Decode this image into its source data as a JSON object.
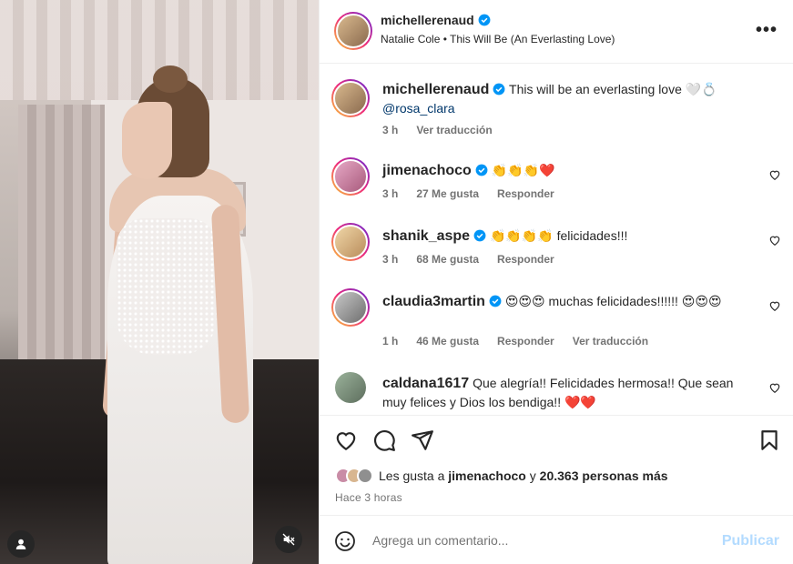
{
  "header": {
    "username": "michellerenaud",
    "music": "Natalie Cole • This Will Be (An Everlasting Love)",
    "more_icon": "more-horizontal-icon"
  },
  "caption": {
    "username": "michellerenaud",
    "text": " This will be an everlasting love 🤍💍",
    "mention": "@rosa_clara",
    "time": "3 h",
    "translate": "Ver traducción"
  },
  "comments": [
    {
      "username": "jimenachoco",
      "text": " 👏👏👏❤️",
      "time": "3 h",
      "likes": "27 Me gusta",
      "reply": "Responder"
    },
    {
      "username": "shanik_aspe",
      "text": " 👏👏👏👏 felicidades!!!",
      "time": "3 h",
      "likes": "68 Me gusta",
      "reply": "Responder"
    },
    {
      "username": "claudia3martin",
      "text": " 😍😍😍 muchas felicidades!!!!!! 😍😍😍",
      "time": "1 h",
      "likes": "46 Me gusta",
      "reply": "Responder",
      "translate": "Ver traducción"
    },
    {
      "username": "caldana1617",
      "text": " Que alegría!! Felicidades hermosa!! Que sean muy felices y Dios los bendiga!! ❤️❤️"
    }
  ],
  "actions": {
    "like_icon": "heart-icon",
    "comment_icon": "comment-icon",
    "share_icon": "send-icon",
    "save_icon": "bookmark-icon"
  },
  "likes": {
    "prefix": "Les gusta a ",
    "user": "jimenachoco",
    "mid": " y ",
    "count": "20.363 personas más"
  },
  "timestamp": "Hace 3 horas",
  "composer": {
    "placeholder": "Agrega un comentario...",
    "publish": "Publicar"
  },
  "colors": {
    "verified": "#0095f6",
    "publish_disabled": "#b3dbff",
    "muted_text": "#737373",
    "heart": "#ed4956"
  }
}
